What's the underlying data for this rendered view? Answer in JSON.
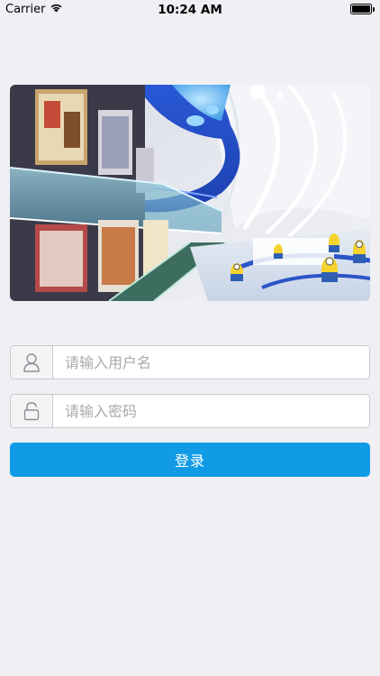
{
  "status_bar": {
    "carrier": "Carrier",
    "time": "10:24 AM",
    "icons": {
      "wifi": "wifi-icon",
      "battery": "battery-icon"
    },
    "battery_level": 1.0
  },
  "banner": {
    "description_icon": "shopping-mall-photo"
  },
  "login_form": {
    "username": {
      "placeholder": "请输入用户名",
      "value": "",
      "icon": "user-icon"
    },
    "password": {
      "placeholder": "请输入密码",
      "value": "",
      "icon": "lock-icon"
    },
    "submit_label": "登录"
  },
  "colors": {
    "background": "#efeff4",
    "accent": "#119be7",
    "field_border": "#c9c9cc"
  }
}
